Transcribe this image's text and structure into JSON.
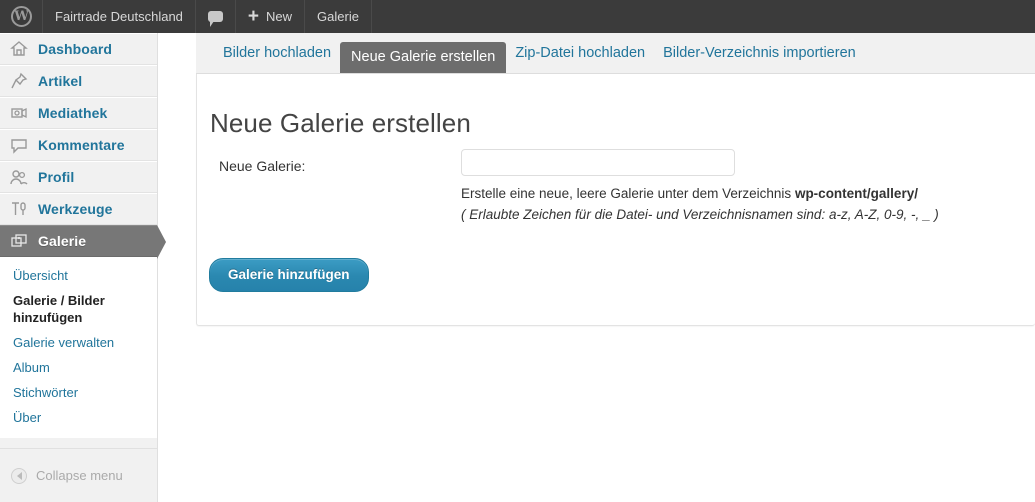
{
  "adminbar": {
    "logo_icon": "wordpress-logo-icon",
    "site_title": "Fairtrade Deutschland",
    "comments_icon": "comment-bubble-icon",
    "new_plus": "+",
    "new_label": "New",
    "gallery_label": "Galerie"
  },
  "sidebar": {
    "items": [
      {
        "label": "Dashboard",
        "icon": "home-icon",
        "name": "dashboard",
        "current": false
      },
      {
        "label": "Artikel",
        "icon": "pushpin-icon",
        "name": "artikel",
        "current": false
      },
      {
        "label": "Mediathek",
        "icon": "media-camera-icon",
        "name": "mediathek",
        "current": false
      },
      {
        "label": "Kommentare",
        "icon": "comment-bubble-icon",
        "name": "kommentare",
        "current": false
      },
      {
        "label": "Profil",
        "icon": "users-icon",
        "name": "profil",
        "current": false
      },
      {
        "label": "Werkzeuge",
        "icon": "tools-icon",
        "name": "werkzeuge",
        "current": false
      },
      {
        "label": "Galerie",
        "icon": "gallery-images-icon",
        "name": "galerie",
        "current": true
      }
    ],
    "submenu": [
      {
        "label": "Übersicht",
        "current": false
      },
      {
        "label": "Galerie / Bilder hinzufügen",
        "current": true
      },
      {
        "label": "Galerie verwalten",
        "current": false
      },
      {
        "label": "Album",
        "current": false
      },
      {
        "label": "Stichwörter",
        "current": false
      },
      {
        "label": "Über",
        "current": false
      }
    ],
    "collapse_label": "Collapse menu",
    "collapse_icon": "collapse-arrow-icon"
  },
  "tabs": [
    {
      "label": "Bilder hochladen",
      "active": false
    },
    {
      "label": "Neue Galerie erstellen",
      "active": true
    },
    {
      "label": "Zip-Datei hochladen",
      "active": false
    },
    {
      "label": "Bilder-Verzeichnis importieren",
      "active": false
    }
  ],
  "main": {
    "title": "Neue Galerie erstellen",
    "field_label": "Neue Galerie:",
    "field_value": "",
    "field_placeholder": "",
    "hint_line1_prefix": "Erstelle eine neue, leere Galerie unter dem Verzeichnis ",
    "hint_line1_bold": "wp-content/gallery/",
    "hint_line2": "( Erlaubte Zeichen für die Datei- und Verzeichnisnamen sind: a-z, A-Z, 0-9, -, _ )",
    "submit_label": "Galerie hinzufügen"
  },
  "colors": {
    "adminbar_bg": "#3b3b3b",
    "sidebar_bg": "#f1f1f1",
    "link_blue": "#21759b",
    "active_gray": "#777777",
    "button_blue": "#2a88b0"
  }
}
